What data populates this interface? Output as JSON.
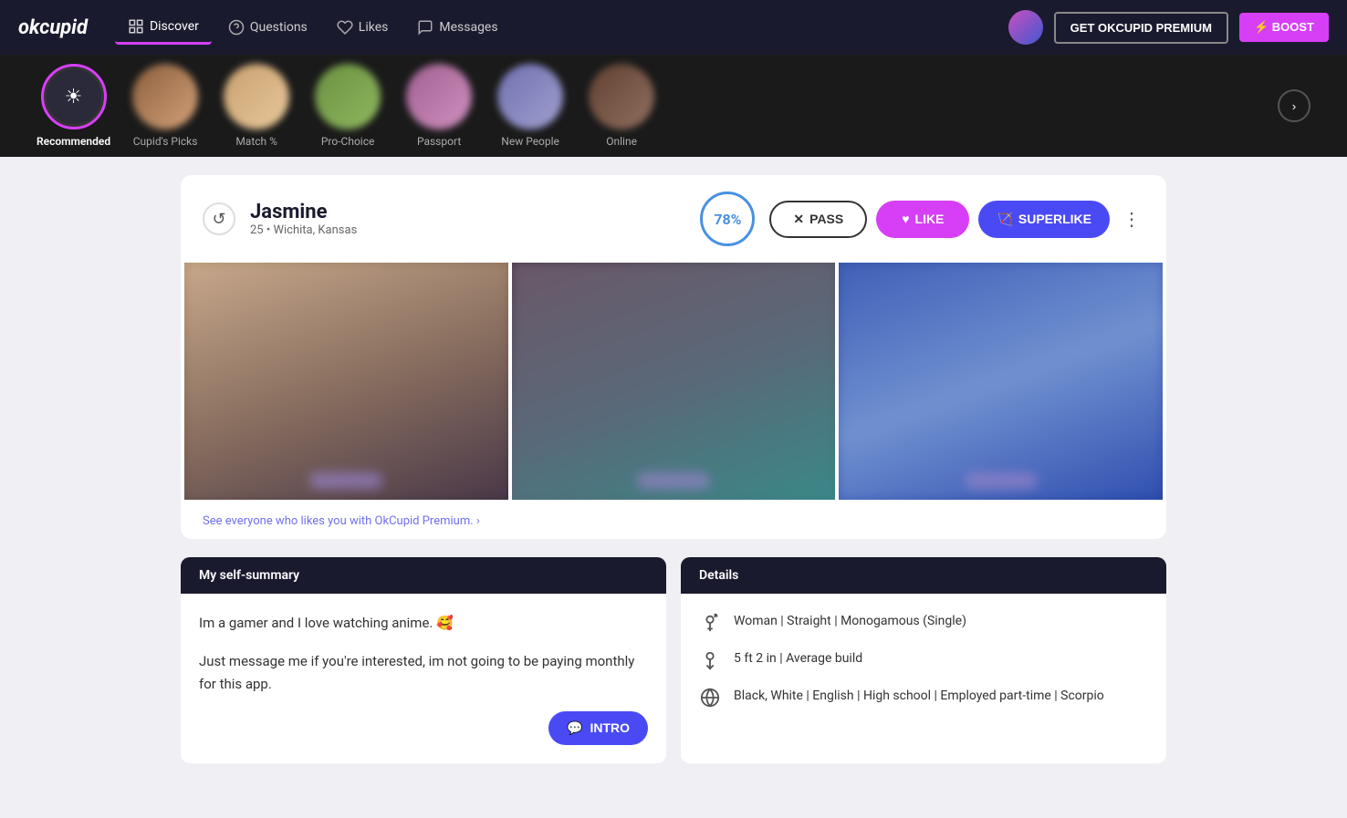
{
  "header": {
    "logo": "okcupid",
    "nav": [
      {
        "label": "Discover",
        "icon": "🔷",
        "active": true
      },
      {
        "label": "Questions",
        "icon": "❓"
      },
      {
        "label": "Likes",
        "icon": "♡"
      },
      {
        "label": "Messages",
        "icon": "💬"
      }
    ],
    "premium_label": "GET OKCUPID PREMIUM",
    "boost_label": "⚡ BOOST"
  },
  "categories": [
    {
      "label": "Recommended",
      "active": true,
      "type": "icon"
    },
    {
      "label": "Cupid's Picks",
      "type": "blur"
    },
    {
      "label": "Match %",
      "type": "blur"
    },
    {
      "label": "Pro-Choice",
      "type": "blur"
    },
    {
      "label": "Passport",
      "type": "blur"
    },
    {
      "label": "New People",
      "type": "blur"
    },
    {
      "label": "Online",
      "type": "blur"
    }
  ],
  "profile": {
    "name": "Jasmine",
    "age": "25",
    "location": "Wichita, Kansas",
    "match_percent": "78%",
    "pass_label": "PASS",
    "like_label": "LIKE",
    "superlike_label": "SUPERLIKE",
    "premium_prompt": "See everyone who likes you with OkCupid Premium. ›",
    "self_summary_header": "My self-summary",
    "self_summary": "Im a gamer and I love watching anime. 🥰\n\nJust message me if you're interested, im not going to be paying monthly for this app.",
    "intro_label": "INTRO",
    "details_header": "Details",
    "details": [
      {
        "icon": "⚤",
        "text": "Woman | Straight | Monogamous (Single)"
      },
      {
        "icon": "📏",
        "text": "5 ft 2 in | Average build"
      },
      {
        "icon": "🌐",
        "text": "Black, White | English | High school | Employed part-time | Scorpio"
      }
    ]
  }
}
